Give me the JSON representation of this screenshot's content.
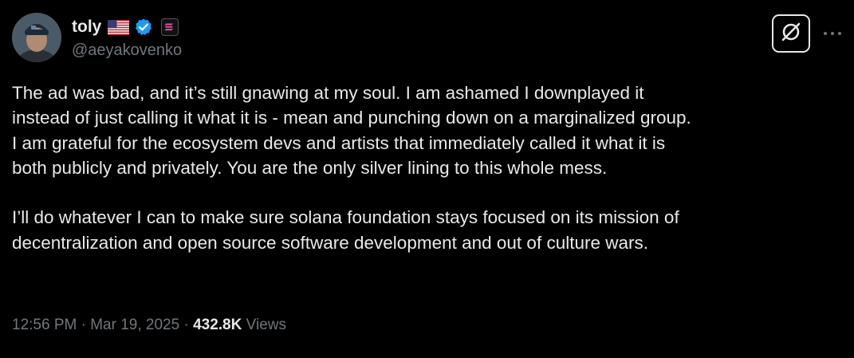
{
  "author": {
    "display_name": "toly",
    "handle": "@aeyakovenko",
    "badges": [
      "us-flag-icon",
      "verified-badge-icon",
      "affiliate-badge-icon"
    ]
  },
  "header_actions": {
    "grok_icon": "grok-icon",
    "more_icon": "more-options-icon"
  },
  "tweet": {
    "paragraph_1": "The ad was bad, and it’s still gnawing at my soul. I am ashamed I downplayed it\ninstead of just calling it what it is - mean and punching down on a marginalized group.\nI am grateful for the ecosystem devs and artists that immediately called it what it is\nboth publicly and privately. You are the only silver lining to this whole mess.",
    "paragraph_2": "I’ll do whatever I can to make sure solana foundation stays focused on its mission of\ndecentralization and open source software development and out of culture wars."
  },
  "meta": {
    "time": "12:56 PM",
    "separator": " · ",
    "date": "Mar 19, 2025",
    "views_count": "432.8K",
    "views_label": "Views"
  },
  "colors": {
    "background": "#000000",
    "primary_text": "#e7e9ea",
    "secondary_text": "#71767b",
    "verified_blue": "#1d9bf0"
  }
}
